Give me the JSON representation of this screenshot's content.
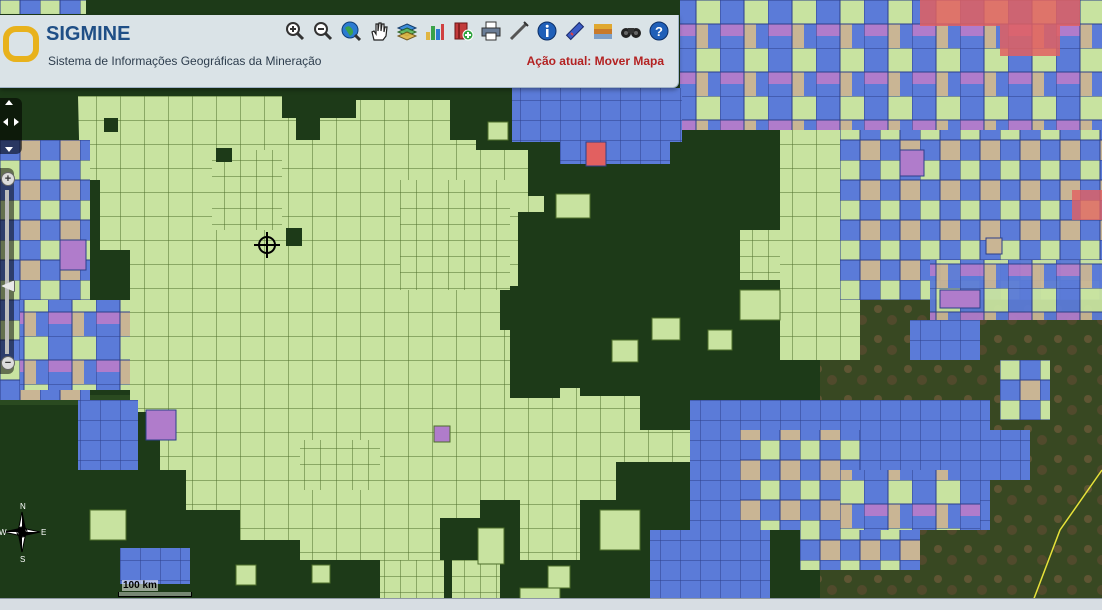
{
  "app": {
    "title": "SIGMINE",
    "subtitle": "Sistema de Informações Geográficas da Mineração",
    "action_label": "Ação atual: Mover Mapa",
    "colors": {
      "title": "#1f4f86",
      "action": "#b32222",
      "logo": "#e8b21c"
    }
  },
  "toolbar": {
    "tools": [
      {
        "name": "zoom-in-icon"
      },
      {
        "name": "zoom-out-icon"
      },
      {
        "name": "full-extent-globe-icon"
      },
      {
        "name": "pan-hand-icon"
      },
      {
        "name": "layers-icon"
      },
      {
        "name": "chart-icon"
      },
      {
        "name": "add-data-book-icon"
      },
      {
        "name": "print-icon"
      },
      {
        "name": "draw-pen-icon"
      },
      {
        "name": "info-icon"
      },
      {
        "name": "measure-icon"
      },
      {
        "name": "geology-icon"
      },
      {
        "name": "binoculars-icon"
      },
      {
        "name": "help-icon"
      }
    ]
  },
  "map": {
    "colors": {
      "forest": "#1d3a18",
      "concession_green": "#c8e3a0",
      "concession_blue": "#5b7bd8",
      "concession_purple": "#b07ccb",
      "concession_tan": "#c9b594",
      "concession_red": "#e26060",
      "parcel_edge": "#3a5a1e"
    },
    "scale_label": "100 km",
    "compass": {
      "north": "N",
      "east": "E",
      "south": "S",
      "west": "W"
    }
  }
}
